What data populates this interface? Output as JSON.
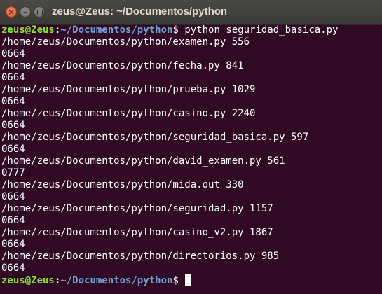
{
  "window": {
    "title": "zeus@Zeus: ~/Documentos/python",
    "buttons": {
      "close_icon": "×",
      "minimize_icon": "–"
    }
  },
  "prompt": {
    "user_host": "zeus@Zeus",
    "separator": ":",
    "path": "~/Documentos/python",
    "dollar": "$ "
  },
  "command": "python seguridad_basica.py",
  "output": [
    "/home/zeus/Documentos/python/examen.py 556",
    "0664",
    "/home/zeus/Documentos/python/fecha.py 841",
    "0664",
    "/home/zeus/Documentos/python/prueba.py 1029",
    "0664",
    "/home/zeus/Documentos/python/casino.py 2240",
    "0664",
    "/home/zeus/Documentos/python/seguridad_basica.py 597",
    "0664",
    "/home/zeus/Documentos/python/david_examen.py 561",
    "0777",
    "/home/zeus/Documentos/python/mida.out 330",
    "0664",
    "/home/zeus/Documentos/python/seguridad.py 1157",
    "0664",
    "/home/zeus/Documentos/python/casino_v2.py 1867",
    "0664",
    "/home/zeus/Documentos/python/directorios.py 985",
    "0664"
  ],
  "colors": {
    "terminal_background": "#300a24",
    "prompt_user": "#8ae234",
    "prompt_path": "#729fcf",
    "text": "#ffffff",
    "titlebar": "#3b3a36",
    "close_button": "#e0592a"
  }
}
